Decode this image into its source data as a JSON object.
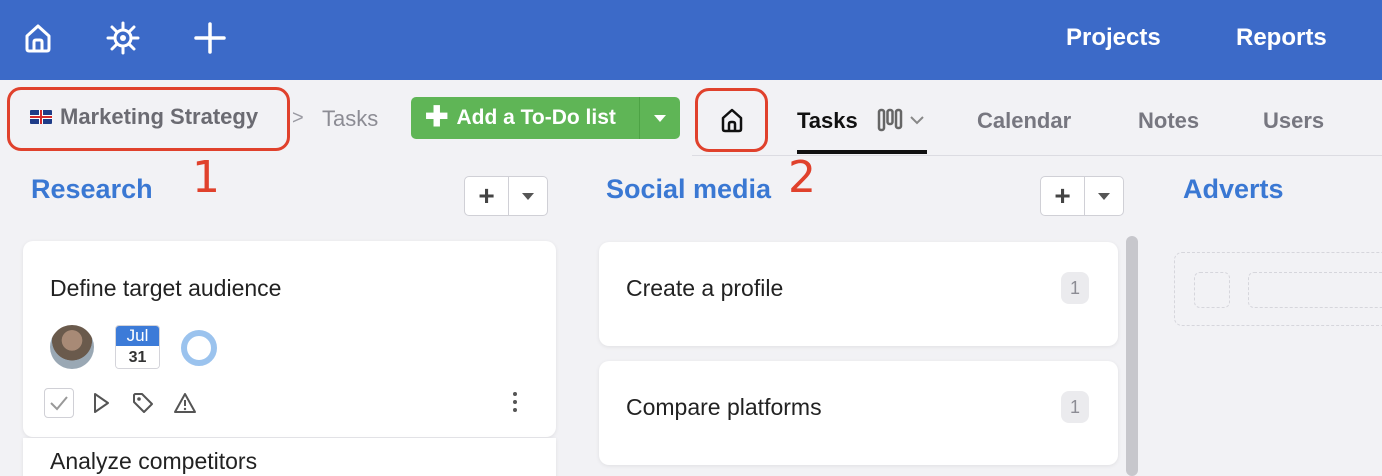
{
  "topbar": {
    "projects_label": "Projects",
    "reports_label": "Reports",
    "bg_color": "#3c6ac8"
  },
  "breadcrumb": {
    "project": "Marketing Strategy",
    "separator": ">",
    "current": "Tasks"
  },
  "add_todo_button": {
    "label": "Add a To-Do list",
    "color": "#5fb556"
  },
  "tabs": {
    "tasks": "Tasks",
    "calendar": "Calendar",
    "notes": "Notes",
    "users": "Users"
  },
  "annotations": {
    "one": "1",
    "two": "2",
    "color": "#e0412c"
  },
  "columns": {
    "research": {
      "title": "Research"
    },
    "social_media": {
      "title": "Social media"
    },
    "adverts": {
      "title": "Adverts"
    }
  },
  "cards": {
    "define_audience": {
      "title": "Define target audience",
      "date_month": "Jul",
      "date_day": "31"
    },
    "analyze_competitors": {
      "title": "Analyze competitors"
    },
    "create_profile": {
      "title": "Create a profile",
      "count": "1"
    },
    "compare_platforms": {
      "title": "Compare platforms",
      "count": "1"
    }
  },
  "icons": [
    "home-icon",
    "helm-icon",
    "plus-icon",
    "uk-flag-icon",
    "board-view-icon",
    "chevron-down-icon",
    "check-icon",
    "play-icon",
    "tag-icon",
    "warning-icon",
    "more-vertical-icon"
  ]
}
